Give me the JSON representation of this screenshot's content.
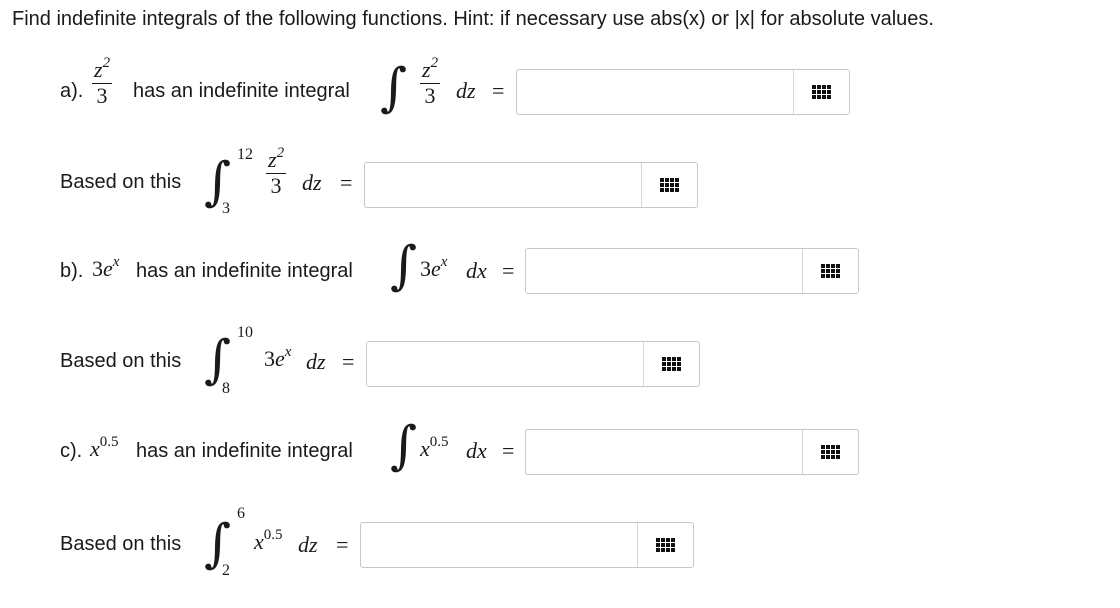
{
  "instructions": "Find indefinite integrals of the following functions. Hint: if necessary use abs(x) or |x| for absolute values.",
  "labels": {
    "has_indefinite": "has an indefinite integral",
    "based_on_this": "Based on this",
    "equals": "="
  },
  "parts": [
    {
      "letter": "a).",
      "integrand_num": "z",
      "integrand_exp": "2",
      "integrand_den": "3",
      "differential": "dz",
      "definite": {
        "upper": "12",
        "lower": "3",
        "differential": "dz"
      }
    },
    {
      "letter": "b).",
      "coef": "3",
      "base": "e",
      "exp": "x",
      "differential": "dx",
      "definite": {
        "upper": "10",
        "lower": "8",
        "differential": "dz"
      }
    },
    {
      "letter": "c).",
      "base": "x",
      "exp": "0.5",
      "differential": "dx",
      "definite": {
        "upper": "6",
        "lower": "2",
        "differential": "dz"
      }
    }
  ],
  "answers": [
    "",
    "",
    "",
    "",
    "",
    ""
  ],
  "keyboard_icon": "keypad-grid-icon"
}
